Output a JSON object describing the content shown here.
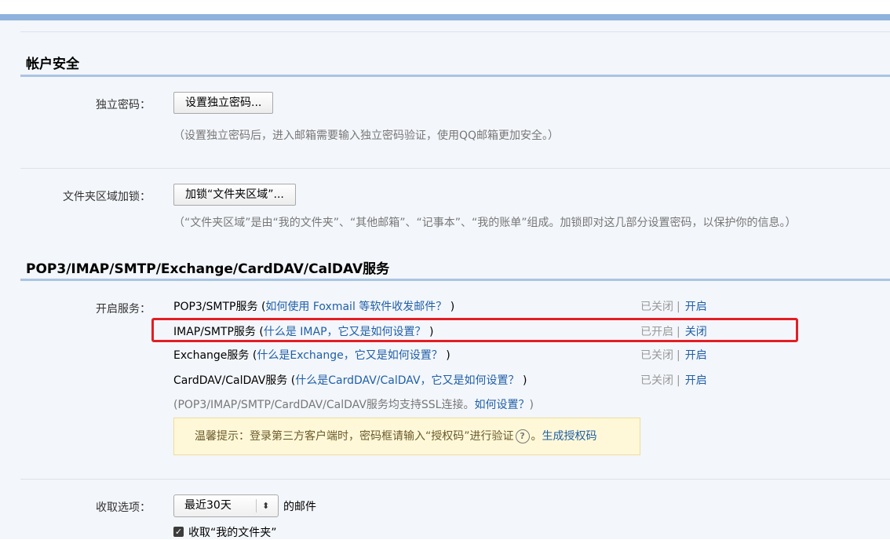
{
  "security": {
    "title": "帐户安全",
    "independent_password": {
      "label": "独立密码：",
      "button": "设置独立密码...",
      "hint": "（设置独立密码后，进入邮箱需要输入独立密码验证，使用QQ邮箱更加安全。）"
    },
    "folder_lock": {
      "label": "文件夹区域加锁：",
      "button": "加锁“文件夹区域”...",
      "hint": "（“文件夹区域”是由“我的文件夹”、“其他邮箱”、“记事本”、“我的账单”组成。加锁即对这几部分设置密码，以保护你的信息。）"
    }
  },
  "services": {
    "title": "POP3/IMAP/SMTP/Exchange/CardDAV/CalDAV服务",
    "label": "开启服务：",
    "items": [
      {
        "name": "POP3/SMTP服务",
        "open": " (",
        "help": "如何使用 Foxmail 等软件收发邮件？",
        "close": " )",
        "status": "已关闭",
        "sep": "|",
        "action": "开启"
      },
      {
        "name": "IMAP/SMTP服务",
        "open": " (",
        "help": "什么是 IMAP，它又是如何设置？",
        "close": " )",
        "status": "已开启",
        "sep": "|",
        "action": "关闭"
      },
      {
        "name": "Exchange服务",
        "open": " (",
        "help": "什么是Exchange，它又是如何设置？",
        "close": " )",
        "status": "已关闭",
        "sep": "|",
        "action": "开启"
      },
      {
        "name": "CardDAV/CalDAV服务",
        "open": " (",
        "help": "什么是CardDAV/CalDAV，它又是如何设置？",
        "close": " )",
        "status": "已关闭",
        "sep": "|",
        "action": "开启"
      }
    ],
    "ssl_note": "(POP3/IMAP/SMTP/CardDAV/CalDAV服务均支持SSL连接。",
    "ssl_link": "如何设置？",
    "ssl_close": ")",
    "tip_text": "温馨提示：登录第三方客户端时，密码框请输入“授权码”进行验证",
    "tip_q": "?",
    "tip_sep": "。",
    "tip_link": "生成授权码"
  },
  "fetch": {
    "label": "收取选项：",
    "select_value": "最近30天",
    "select_arrows": "⬍",
    "suffix": "的邮件",
    "checkbox_label": "收取“我的文件夹”",
    "checkbox_mark": "✓"
  }
}
